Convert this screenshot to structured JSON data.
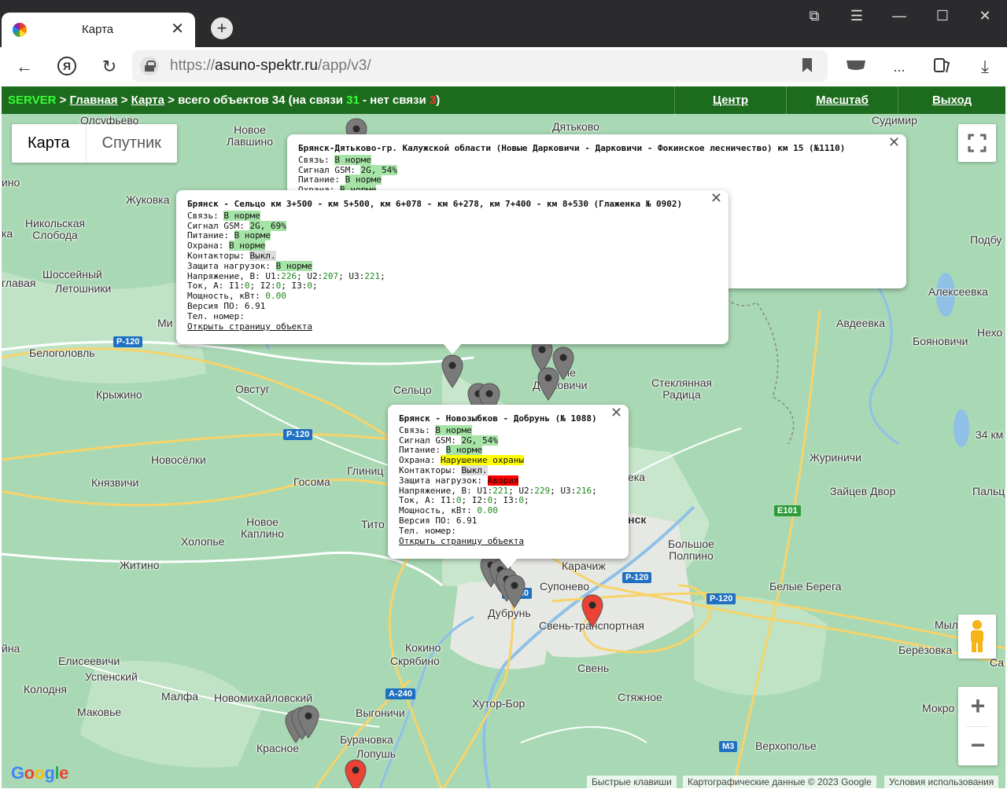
{
  "browser": {
    "tab_title": "Карта",
    "url_prefix": "https://",
    "url_domain": "asuno-spektr.ru",
    "url_path": "/app/v3/",
    "menu_dots": "..."
  },
  "header": {
    "server": "SERVER",
    "sep": " > ",
    "home_link": "Главная",
    "map_link": "Карта",
    "total_text": "всего объектов 34 (на связи",
    "online_count": "31",
    "dash_text": "- нет связи",
    "offline_count": "3",
    "close_paren": ")",
    "nav": [
      "Центр",
      "Масштаб",
      "Выход"
    ]
  },
  "map": {
    "type_map": "Карта",
    "type_satellite": "Спутник",
    "places": [
      "Олсуфьево",
      "Новое\nЛавшино",
      "Дятьково",
      "Судимир",
      "Жуковка",
      "Никольская\nСлобода",
      "Шоссейный",
      "Летошники",
      "Белоголовль",
      "Крыжино",
      "Овстуг",
      "Сельцо",
      "Стеклянная\nРадица",
      "Новосёлки",
      "Князвичи",
      "Госома",
      "Глиниц",
      "Новое\nКаплино",
      "Холопье",
      "Житино",
      "Тито",
      "Карачиж",
      "Супонево",
      "Большое\nПолпино",
      "Белые Берега",
      "Дубрунь",
      "Свень-транспортная",
      "Свень",
      "Кокино",
      "Скрябино",
      "Елисеевичи",
      "Успенский",
      "Колодня",
      "Малфа",
      "Новомихайловский",
      "Маковье",
      "Выгоничи",
      "Хутор-Бор",
      "Стяжное",
      "Красное",
      "Бурачовка",
      "Лопушь",
      "Верхополье",
      "Авдеевка",
      "Алексеевка",
      "Бояновичи",
      "Журиничи",
      "Зайцев Двор",
      "Мылинк",
      "Берёзовка",
      "Мокро",
      "Подбу",
      "Нехо",
      "Пальц",
      "Са",
      "ино",
      "ка",
      "главая",
      "йна",
      "Ми",
      "34 км",
      "янск",
      "ека",
      "ые",
      "Дарковичи"
    ],
    "roads": [
      "P-120",
      "P-120",
      "P-120",
      "P-120",
      "A-240",
      "A-240",
      "E101",
      "M3"
    ],
    "attribution": [
      "Быстрые клавиши",
      "Картографические данные © 2023 Google",
      "Условия использования"
    ],
    "logo": "Google"
  },
  "popups": {
    "p1110": {
      "title": "Брянск-Дятьково-гр. Калужской области (Новые Дарковичи - Дарковичи - Фокинское лесничество) км 15 (№1110)",
      "svyaz_label": "Связь:",
      "svyaz_val": "В норме",
      "gsm_label": "Сигнал GSM:",
      "gsm_val": "2G, 54%",
      "pit_label": "Питание:",
      "pit_val": "В норме",
      "ohr_label": "Охрана:",
      "ohr_val": "В норме"
    },
    "p0902": {
      "title": "Брянск - Сельцо км 3+500 - км 5+500, км 6+078 - км 6+278, км 7+400 - км 8+530 (Глаженка № 0902)",
      "svyaz_label": "Связь:",
      "svyaz_val": "В норме",
      "gsm_label": "Сигнал GSM:",
      "gsm_val": "2G, 69%",
      "pit_label": "Питание:",
      "pit_val": "В норме",
      "ohr_label": "Охрана:",
      "ohr_val": "В норме",
      "kont_label": "Контакторы:",
      "kont_val": "Выкл.",
      "zash_label": "Защита нагрузок:",
      "zash_val": "В норме",
      "u_label": "Напряжение, В:",
      "u1_label": "U1:",
      "u1": "226",
      "u2_label": "U2:",
      "u2": "207",
      "u3_label": "U3:",
      "u3": "221",
      "i_label": "Ток, А:",
      "i1_label": "I1:",
      "i1": "0",
      "i2_label": "I2:",
      "i2": "0",
      "i3_label": "I3:",
      "i3": "0",
      "p_label": "Мощность, кВт:",
      "p_val": "0.00",
      "ver_label": "Версия ПО:",
      "ver_val": "6.91",
      "tel_label": "Тел. номер:",
      "open_link": "Открыть страницу объекта"
    },
    "p1088": {
      "title": "Брянск - Новозыбков - Добрунь (№ 1088)",
      "svyaz_label": "Связь:",
      "svyaz_val": "В норме",
      "gsm_label": "Сигнал GSM:",
      "gsm_val": "2G, 54%",
      "pit_label": "Питание:",
      "pit_val": "В норме",
      "ohr_label": "Охрана:",
      "ohr_val": "Нарушение охраны",
      "kont_label": "Контакторы:",
      "kont_val": "Выкл.",
      "zash_label": "Защита нагрузок:",
      "zash_val": "Авария",
      "u_label": "Напряжение, В:",
      "u1_label": "U1:",
      "u1": "221",
      "u2_label": "U2:",
      "u2": "229",
      "u3_label": "U3:",
      "u3": "216",
      "i_label": "Ток, А:",
      "i1_label": "I1:",
      "i1": "0",
      "i2_label": "I2:",
      "i2": "0",
      "i3_label": "I3:",
      "i3": "0",
      "p_label": "Мощность, кВт:",
      "p_val": "0.00",
      "ver_label": "Версия ПО:",
      "ver_val": "6.91",
      "tel_label": "Тел. номер:",
      "open_link": "Открыть страницу объекта"
    }
  },
  "colors": {
    "header_bg": "#1d6b1d",
    "map_bg": "#a9d9b4",
    "pin_gray": "#7a7a7a",
    "pin_red": "#ea4335",
    "status_ok": "#a6e3a6",
    "status_warn": "#ffff00",
    "status_alarm": "#ff0000"
  },
  "icons": [
    "back-arrow-icon",
    "yandex-icon",
    "reload-icon",
    "lock-icon",
    "bookmark-icon",
    "download-icon",
    "fullscreen-icon",
    "pegman-icon",
    "zoom-in-icon",
    "zoom-out-icon",
    "map-pin-icon"
  ]
}
